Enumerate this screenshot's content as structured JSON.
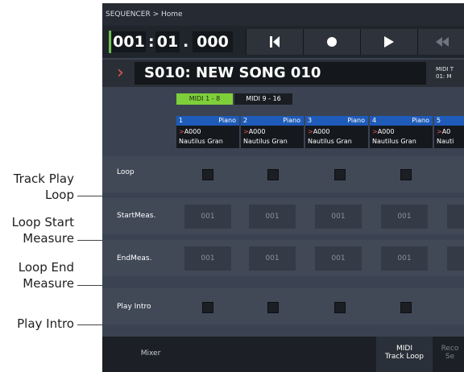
{
  "callouts": [
    {
      "line1": "Track Play",
      "line2": "Loop"
    },
    {
      "line1": "Loop Start",
      "line2": "Measure"
    },
    {
      "line1": "Loop End",
      "line2": "Measure"
    },
    {
      "line1": "Play Intro",
      "line2": ""
    }
  ],
  "breadcrumb": "SEQUENCER > Home",
  "position": {
    "measure": "001",
    "beat": "01",
    "tick": "000"
  },
  "transport": {
    "icons": [
      "skip-to-start-icon",
      "record-icon",
      "play-icon",
      "rewind-icon"
    ]
  },
  "song": {
    "name": "S010: NEW SONG 010",
    "midi_line1": "MIDI T",
    "midi_line2": "01: M"
  },
  "tabs": [
    {
      "label": "MIDI 1 - 8",
      "active": true
    },
    {
      "label": "MIDI 9 - 16",
      "active": false
    }
  ],
  "tracks": [
    {
      "num": "1",
      "inst": "Piano",
      "prog": "A000",
      "name": "Nautilus Gran"
    },
    {
      "num": "2",
      "inst": "Piano",
      "prog": "A000",
      "name": "Nautilus Gran"
    },
    {
      "num": "3",
      "inst": "Piano",
      "prog": "A000",
      "name": "Nautilus Gran"
    },
    {
      "num": "4",
      "inst": "Piano",
      "prog": "A000",
      "name": "Nautilus Gran"
    },
    {
      "num": "5",
      "inst": "",
      "prog": "A0",
      "name": "Nauti"
    }
  ],
  "rows": {
    "loop": "Loop",
    "start": "StartMeas.",
    "end": "EndMeas.",
    "intro": "Play Intro"
  },
  "field_values": {
    "start": "001",
    "end": "001"
  },
  "bottom": {
    "mixer": "Mixer",
    "midi_track_loop_1": "MIDI",
    "midi_track_loop_2": "Track Loop",
    "rec_1": "Reco",
    "rec_2": "Se"
  },
  "colors": {
    "accent_green": "#7fcf3a",
    "track_blue": "#1f5bb8",
    "arrow_red": "#e2574c"
  }
}
